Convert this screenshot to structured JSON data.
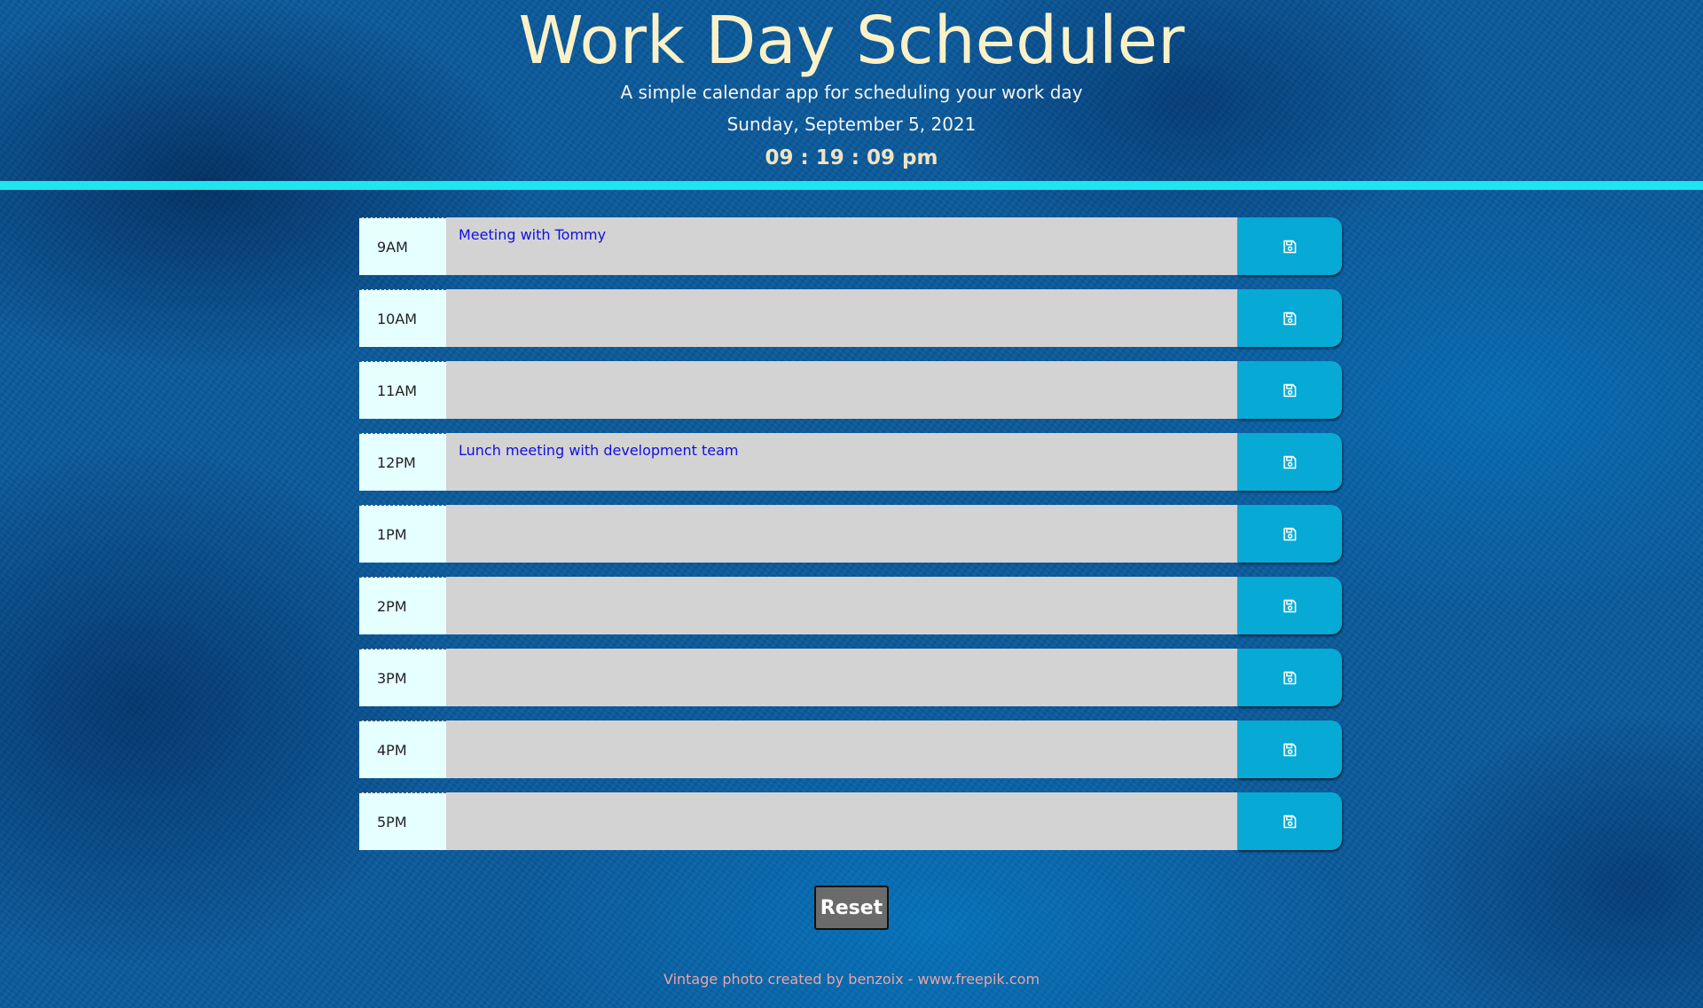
{
  "header": {
    "title": "Work Day Scheduler",
    "subtitle": "A simple calendar app for scheduling your work day",
    "date": "Sunday, September 5, 2021",
    "clock": "09 : 19 : 09 pm"
  },
  "schedule": {
    "rows": [
      {
        "hour": "9AM",
        "text": "Meeting with Tommy"
      },
      {
        "hour": "10AM",
        "text": ""
      },
      {
        "hour": "11AM",
        "text": ""
      },
      {
        "hour": "12PM",
        "text": "Lunch meeting with development team"
      },
      {
        "hour": "1PM",
        "text": ""
      },
      {
        "hour": "2PM",
        "text": ""
      },
      {
        "hour": "3PM",
        "text": ""
      },
      {
        "hour": "4PM",
        "text": ""
      },
      {
        "hour": "5PM",
        "text": ""
      }
    ],
    "save_icon": "save-icon"
  },
  "reset_label": "Reset",
  "credit": "Vintage photo created by benzoix - www.freepik.com",
  "colors": {
    "title": "#fbf1c9",
    "divider": "#1de6f0",
    "hour_bg": "#e6ffff",
    "textarea_bg": "#d3d3d3",
    "save_bg": "#06aad4",
    "entry_text": "#1010e0",
    "reset_bg": "#6b6b6b",
    "credit": "#e8a4a4"
  }
}
